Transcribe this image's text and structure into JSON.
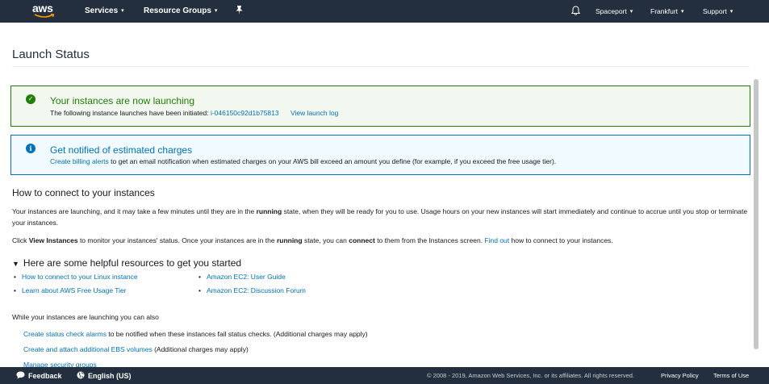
{
  "header": {
    "logo": "aws",
    "services": "Services",
    "resource_groups": "Resource Groups",
    "account": "Spaceport",
    "region": "Frankfurt",
    "support": "Support"
  },
  "page": {
    "title": "Launch Status"
  },
  "success_alert": {
    "title": "Your instances are now launching",
    "body": "The following instance launches have been initiated:",
    "instance_id": "i-046150c92d1b75813",
    "view_log": "View launch log"
  },
  "info_alert": {
    "title": "Get notified of estimated charges",
    "link": "Create billing alerts",
    "body": "to get an email notification when estimated charges on your AWS bill exceed an amount you define (for example, if you exceed the free usage tier)."
  },
  "connect": {
    "heading": "How to connect to your instances",
    "p1_a": "Your instances are launching, and it may take a few minutes until they are in the ",
    "p1_b": "running",
    "p1_c": " state, when they will be ready for you to use. Usage hours on your new instances will start immediately and continue to accrue until you stop or terminate your instances.",
    "p2_a": "Click ",
    "p2_b": "View Instances",
    "p2_c": " to monitor your instances' status. Once your instances are in the ",
    "p2_d": "running",
    "p2_e": " state, you can ",
    "p2_f": "connect",
    "p2_g": " to them from the Instances screen. ",
    "p2_link": "Find out",
    "p2_h": " how to connect to your instances."
  },
  "resources": {
    "heading": "Here are some helpful resources to get you started",
    "col1": [
      "How to connect to your Linux instance",
      "Learn about AWS Free Usage Tier"
    ],
    "col2": [
      "Amazon EC2: User Guide",
      "Amazon EC2: Discussion Forum"
    ]
  },
  "while_launching": {
    "heading": "While your instances are launching you can also",
    "item1_link": "Create status check alarms",
    "item1_text": " to be notified when these instances fail status checks. (Additional charges may apply)",
    "item2_link": "Create and attach additional EBS volumes",
    "item2_text": " (Additional charges may apply)",
    "item3_link": "Manage security groups"
  },
  "footer": {
    "feedback": "Feedback",
    "language": "English (US)",
    "copyright": "© 2008 - 2019, Amazon Web Services, Inc. or its affiliates. All rights reserved.",
    "privacy": "Privacy Policy",
    "terms": "Terms of Use"
  },
  "colors": {
    "header_bg": "#232f3e",
    "success": "#1d8102",
    "info": "#0073bb",
    "link": "#0073bb"
  }
}
